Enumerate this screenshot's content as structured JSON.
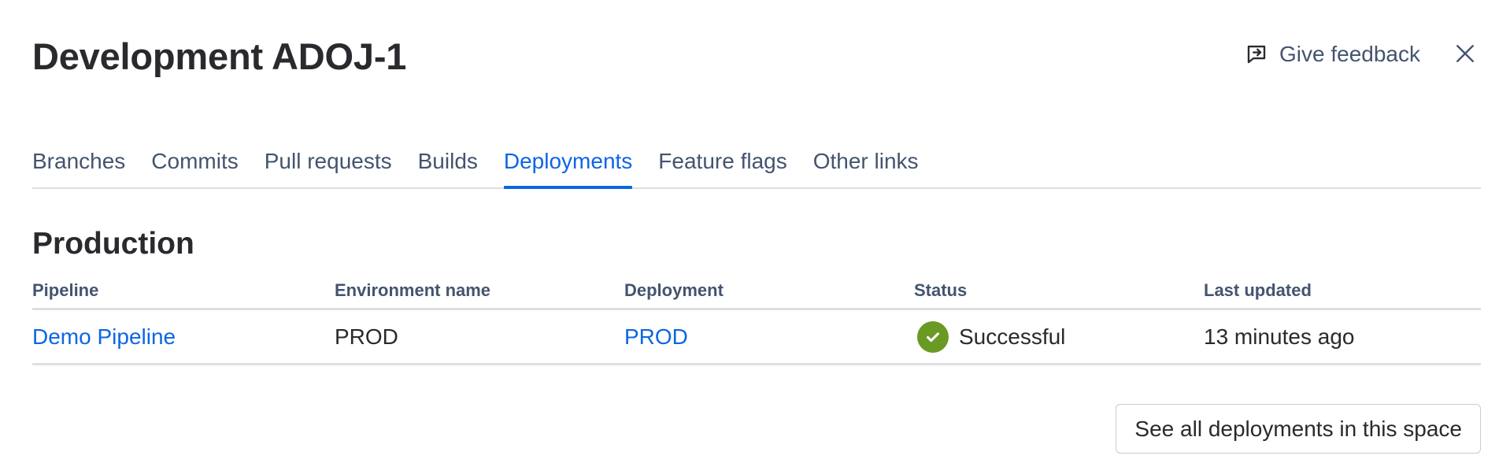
{
  "header": {
    "title": "Development ADOJ-1",
    "feedback_label": "Give feedback",
    "feedback_icon": "feedback-icon",
    "close_icon": "close-icon"
  },
  "tabs": [
    {
      "label": "Branches",
      "active": false
    },
    {
      "label": "Commits",
      "active": false
    },
    {
      "label": "Pull requests",
      "active": false
    },
    {
      "label": "Builds",
      "active": false
    },
    {
      "label": "Deployments",
      "active": true
    },
    {
      "label": "Feature flags",
      "active": false
    },
    {
      "label": "Other links",
      "active": false
    }
  ],
  "section": {
    "title": "Production"
  },
  "table": {
    "columns": [
      "Pipeline",
      "Environment name",
      "Deployment",
      "Status",
      "Last updated"
    ],
    "rows": [
      {
        "pipeline": "Demo Pipeline",
        "environment": "PROD",
        "deployment": "PROD",
        "status": "Successful",
        "status_icon": "check-circle-icon",
        "last_updated": "13 minutes ago"
      }
    ]
  },
  "footer": {
    "see_all_label": "See all deployments in this space"
  },
  "colors": {
    "accent": "#0c66e4",
    "success": "#6a9a23",
    "text": "#292a2e",
    "subtle_text": "#44546f",
    "divider": "#dcdfe4"
  }
}
